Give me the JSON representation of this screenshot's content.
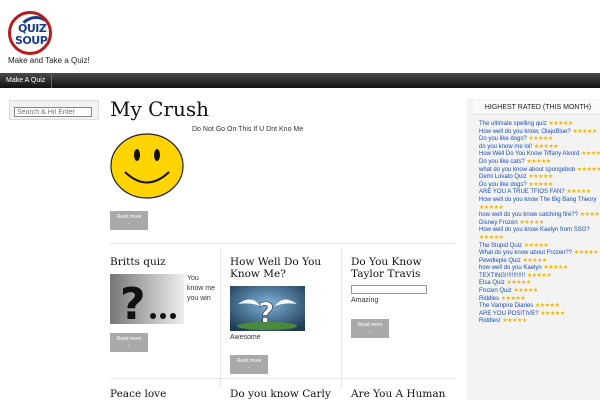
{
  "header": {
    "logo_line1": "QUIZ",
    "logo_line2": "SOUP",
    "tagline": "Make and Take a Quiz!"
  },
  "nav": {
    "items": [
      "Make A Quiz"
    ]
  },
  "search": {
    "placeholder": "Search & Hit Enter"
  },
  "main": {
    "title": "My Crush",
    "description": "Do Not Go On This If U Dnt Kno Me",
    "read_more": "Read more",
    "read_more_dash": "-"
  },
  "cards": [
    {
      "title": "Britts quiz",
      "text": "You know me you win"
    },
    {
      "title": "How Well Do You Know Me?",
      "text": "Awesome"
    },
    {
      "title": "Do You Know Taylor Travis",
      "text": "Amazing"
    },
    {
      "title": "Peace love",
      "text": ""
    },
    {
      "title": "Do you know Carly",
      "text": ""
    },
    {
      "title": "Are You A Human",
      "text": ""
    }
  ],
  "sidebar": {
    "heading": "HIGHEST RATED (THIS MONTH)",
    "items": [
      {
        "label": "The ultimate spelling quiz",
        "stars": "★★★★★"
      },
      {
        "label": "How well do you know, OlajoBlue?",
        "stars": "★★★★★"
      },
      {
        "label": "Do you like dogs?",
        "stars": "★★★★★"
      },
      {
        "label": "do you know me lol!",
        "stars": "★★★★★"
      },
      {
        "label": "How Well Do You Know Tiffany Alvord",
        "stars": "★★★★★"
      },
      {
        "label": "Do you like cats?",
        "stars": "★★★★★"
      },
      {
        "label": "what do you know about spongebob",
        "stars": "★★★★★"
      },
      {
        "label": "Demi Lovato Quiz",
        "stars": "★★★★★"
      },
      {
        "label": "Do you like dogs?",
        "stars": "★★★★★"
      },
      {
        "label": "ARE YOU A TRUE TFIOS FAN?",
        "stars": "★★★★★"
      },
      {
        "label": "How well do you know The Big Bang Theory",
        "stars": "★★★★★"
      },
      {
        "label": "how well do you know catching fire??",
        "stars": "★★★★★"
      },
      {
        "label": "Disney Frozen",
        "stars": "★★★★★"
      },
      {
        "label": "How well do you know Kaelyn from SSG?",
        "stars": "★★★★★"
      },
      {
        "label": "The Stupid Quiz",
        "stars": "★★★★★"
      },
      {
        "label": "What do you know about Frozen??",
        "stars": "★★★★★"
      },
      {
        "label": "Pewdiepie Quiz",
        "stars": "★★★★★"
      },
      {
        "label": "how well do you Kaelyn",
        "stars": "★★★★★"
      },
      {
        "label": "TEXTING!!!!!!!!!!!!",
        "stars": "★★★★★"
      },
      {
        "label": "Elsa Quiz",
        "stars": "★★★★★"
      },
      {
        "label": "Frozen Quiz",
        "stars": "★★★★★"
      },
      {
        "label": "Riddles",
        "stars": "★★★★★"
      },
      {
        "label": "The Vampire Diaries",
        "stars": "★★★★★"
      },
      {
        "label": "ARE YOU POSITIVE?",
        "stars": "★★★★★"
      },
      {
        "label": "Riddles!",
        "stars": "★★★★★"
      }
    ]
  }
}
